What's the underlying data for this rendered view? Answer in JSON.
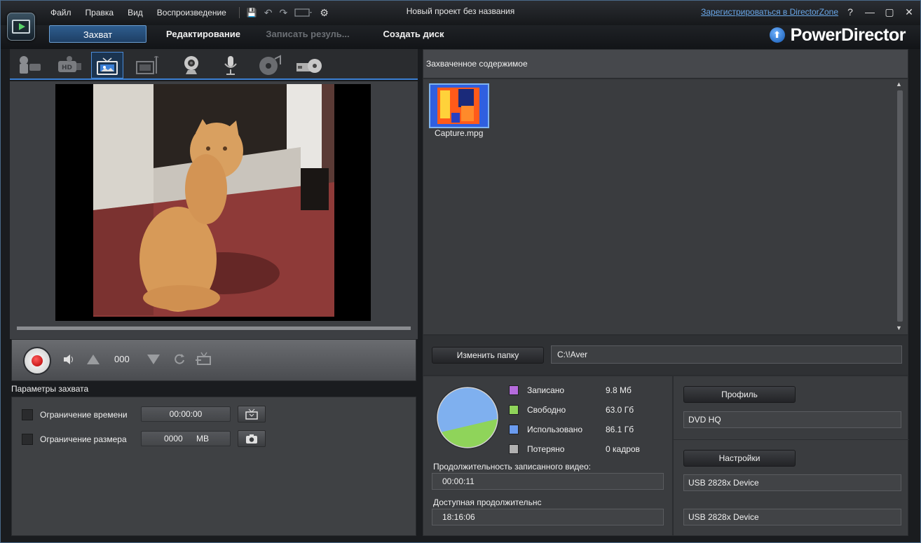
{
  "window": {
    "title": "Новый проект без названия",
    "register_link": "Зарегистрироваться в DirectorZone",
    "help": "?",
    "minimize": "—",
    "maximize": "▢",
    "close": "✕"
  },
  "menu": [
    "Файл",
    "Правка",
    "Вид",
    "Воспроизведение"
  ],
  "quick_access": {
    "save": "💾",
    "undo": "↶",
    "redo": "↷",
    "settings": "⚙"
  },
  "modes": {
    "capture": "Захват",
    "edit": "Редактирование",
    "produce": "Записать резуль...",
    "disc": "Создать диск"
  },
  "brand": "PowerDirector",
  "capture_sources": [
    {
      "name": "webcam-dv"
    },
    {
      "name": "hdv"
    },
    {
      "name": "tv"
    },
    {
      "name": "digital-tv"
    },
    {
      "name": "webcam"
    },
    {
      "name": "microphone"
    },
    {
      "name": "cd"
    },
    {
      "name": "dvd"
    }
  ],
  "controls": {
    "counter": "000"
  },
  "params": {
    "title": "Параметры захвата",
    "time_limit_label": "Ограничение времени",
    "time_limit_value": "00:00:00",
    "size_limit_label": "Ограничение размера",
    "size_limit_value": "0000",
    "size_unit": "MB"
  },
  "library": {
    "header": "Захваченное содержимое",
    "items": [
      {
        "label": "Capture.mpg"
      }
    ]
  },
  "folder": {
    "change_button": "Изменить папку",
    "path": "C:\\!Aver"
  },
  "disk": {
    "legend": [
      {
        "label": "Записано",
        "value": "9.8  Мб",
        "color": "#b56bdc"
      },
      {
        "label": "Свободно",
        "value": "63.0  Гб",
        "color": "#8fd45a"
      },
      {
        "label": "Использовано",
        "value": "86.1  Гб",
        "color": "#6a9bef"
      },
      {
        "label": "Потеряно",
        "value": "0 кадров",
        "color": "#b0b0b0"
      }
    ],
    "recorded_duration_label": "Продолжительность записанного видео:",
    "recorded_duration": "00:00:11",
    "available_duration_label": "Доступная продолжительнс",
    "available_duration": "18:16:06"
  },
  "profile": {
    "profile_button": "Профиль",
    "profile_value": "DVD HQ",
    "settings_button": "Настройки",
    "device_1": "USB 2828x Device",
    "device_2": "USB 2828x Device"
  }
}
